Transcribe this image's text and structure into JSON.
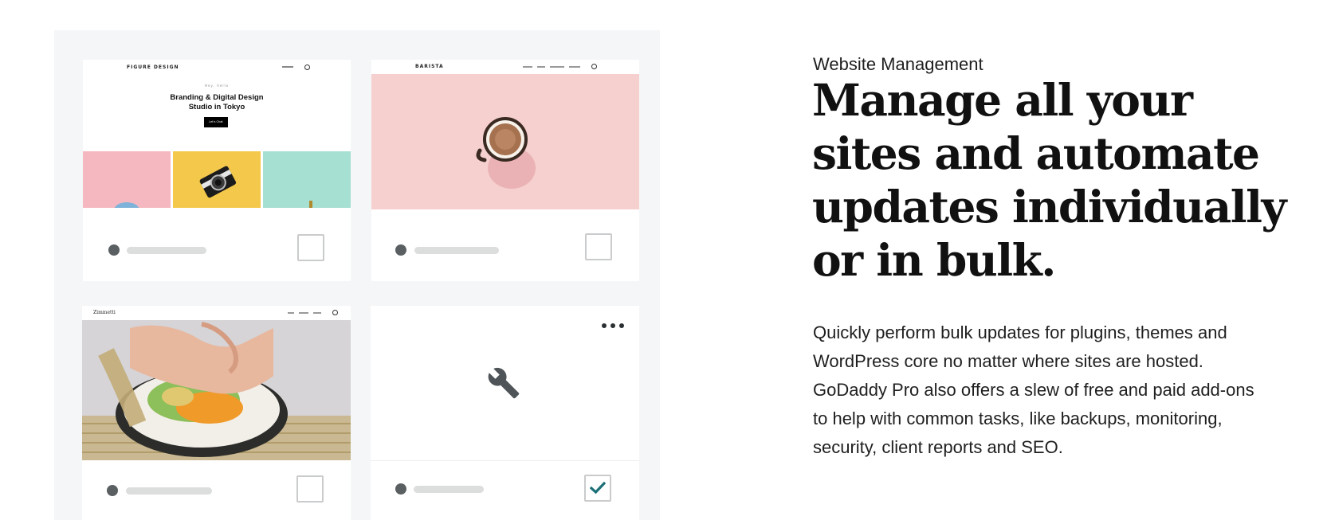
{
  "cards": [
    {
      "site": {
        "brand": "FIGURE DESIGN",
        "eyebrow": "Hey, hello",
        "title_line1": "Branding & Digital Design",
        "title_line2": "Studio in Tokyo",
        "cta": "Let's Chat"
      },
      "selected": false
    },
    {
      "site": {
        "brand": "BARISTA"
      },
      "selected": false
    },
    {
      "site": {
        "brand": "Zimmetti"
      },
      "selected": false
    },
    {
      "site": {
        "placeholder_icon": "wrench-icon",
        "menu_icon": "more-horizontal-icon"
      },
      "selected": true
    }
  ],
  "content": {
    "eyebrow": "Website Management",
    "headline": "Manage all your sites and automate updates individually or in bulk.",
    "body": "Quickly perform bulk updates for plugins, themes and WordPress core no matter where sites are hosted. GoDaddy Pro also offers a slew of free and paid add-ons to help with common tasks, like backups, monitoring, security, client reports and SEO."
  },
  "colors": {
    "panel_bg": "#f5f6f7",
    "check_teal": "#1b6f76",
    "dot": "#5a5f62",
    "bar": "#dcdddd"
  }
}
